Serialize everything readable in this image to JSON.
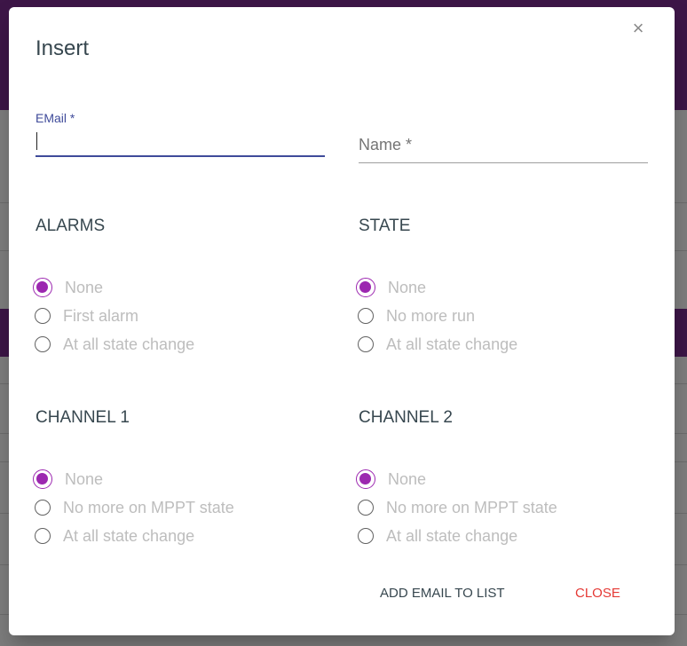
{
  "dialog": {
    "title": "Insert",
    "close_icon": "close-icon"
  },
  "fields": {
    "email": {
      "label": "EMail *",
      "value": "",
      "focused": true
    },
    "name": {
      "label": "Name *",
      "value": ""
    }
  },
  "sections": [
    {
      "title": "ALARMS",
      "options": [
        "None",
        "First alarm",
        "At all state change"
      ],
      "selected": "None"
    },
    {
      "title": "STATE",
      "options": [
        "None",
        "No more run",
        "At all state change"
      ],
      "selected": "None"
    },
    {
      "title": "CHANNEL 1",
      "options": [
        "None",
        "No more on MPPT state",
        "At all state change"
      ],
      "selected": "None"
    },
    {
      "title": "CHANNEL 2",
      "options": [
        "None",
        "No more on MPPT state",
        "At all state change"
      ],
      "selected": "None"
    }
  ],
  "actions": {
    "add": "ADD EMAIL TO LIST",
    "close": "CLOSE"
  },
  "colors": {
    "accent": "#9c27b0",
    "focus": "#3f4b9a",
    "danger": "#e53935",
    "header": "#7b2c8f"
  }
}
